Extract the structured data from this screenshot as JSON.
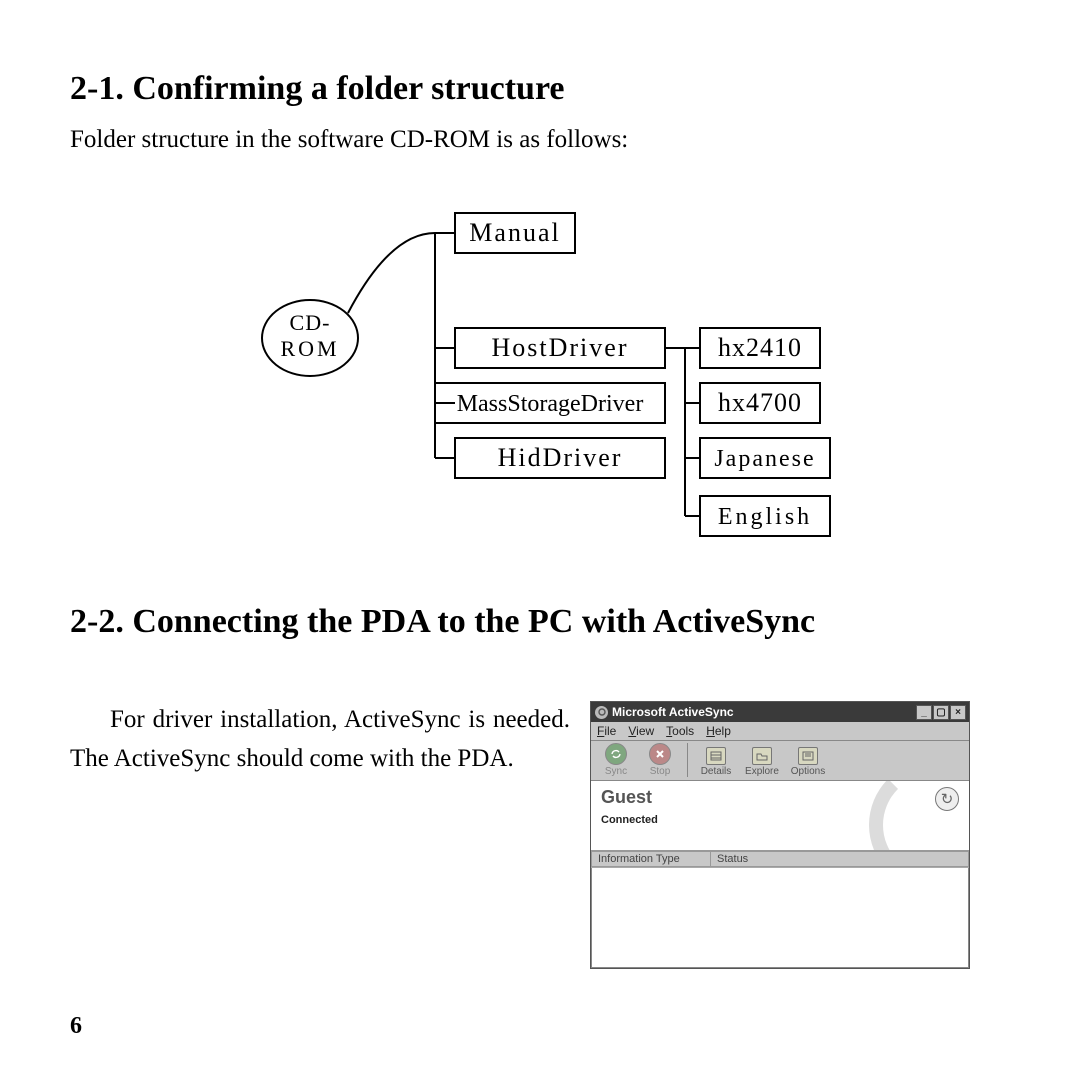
{
  "section1": {
    "heading": "2-1. Confirming a folder structure",
    "body": "Folder structure in the software CD-ROM is as follows:"
  },
  "diagram": {
    "root": "CD-\nROM",
    "nodes": {
      "manual": "Manual",
      "hostdriver": "HostDriver",
      "massstorage": "MassStorageDriver",
      "hiddriver": "HidDriver",
      "hx2410": "hx2410",
      "hx4700": "hx4700",
      "japanese": "Japanese",
      "english": "English"
    }
  },
  "section2": {
    "heading": "2-2. Connecting the PDA to the PC with ActiveSync",
    "body": "For driver installation, ActiveSync is needed. The ActiveSync should come with the PDA."
  },
  "activesync": {
    "title": "Microsoft ActiveSync",
    "menu": {
      "file": "File",
      "view": "View",
      "tools": "Tools",
      "help": "Help"
    },
    "toolbar": {
      "sync": "Sync",
      "stop": "Stop",
      "details": "Details",
      "explore": "Explore",
      "options": "Options"
    },
    "guest": "Guest",
    "connected": "Connected",
    "columns": {
      "info": "Information Type",
      "status": "Status"
    }
  },
  "page": "6"
}
